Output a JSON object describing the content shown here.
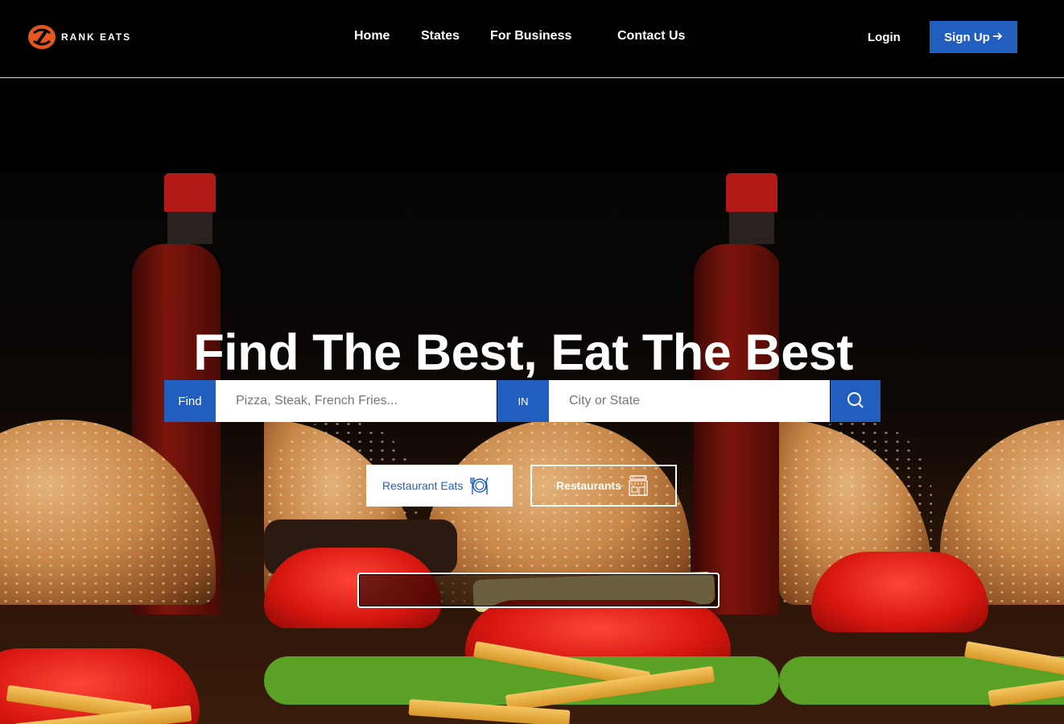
{
  "brand": {
    "name": "RANK EATS",
    "accent": "#e4571f",
    "primary": "#215ebd",
    "logo_icon": "rank-eats-logo-icon"
  },
  "nav": {
    "items": [
      {
        "label": "Home"
      },
      {
        "label": "States"
      },
      {
        "label": "For Business"
      },
      {
        "label": "Contact Us"
      }
    ],
    "login_label": "Login",
    "signup_label": "Sign Up",
    "signup_icon": "arrow-right-icon"
  },
  "hero": {
    "title": "Find The Best, Eat The Best",
    "background": "burger-and-fries-photo"
  },
  "search": {
    "find_label": "Find",
    "find_placeholder": "Pizza, Steak, French Fries...",
    "in_label": "IN",
    "location_placeholder": "City or State",
    "submit_icon": "search-icon"
  },
  "tabs": [
    {
      "label": "Restaurant Eats",
      "icon": "plate-cutlery-icon",
      "active": true
    },
    {
      "label": "Restaurants",
      "icon": "restaurant-building-icon",
      "active": false
    }
  ]
}
